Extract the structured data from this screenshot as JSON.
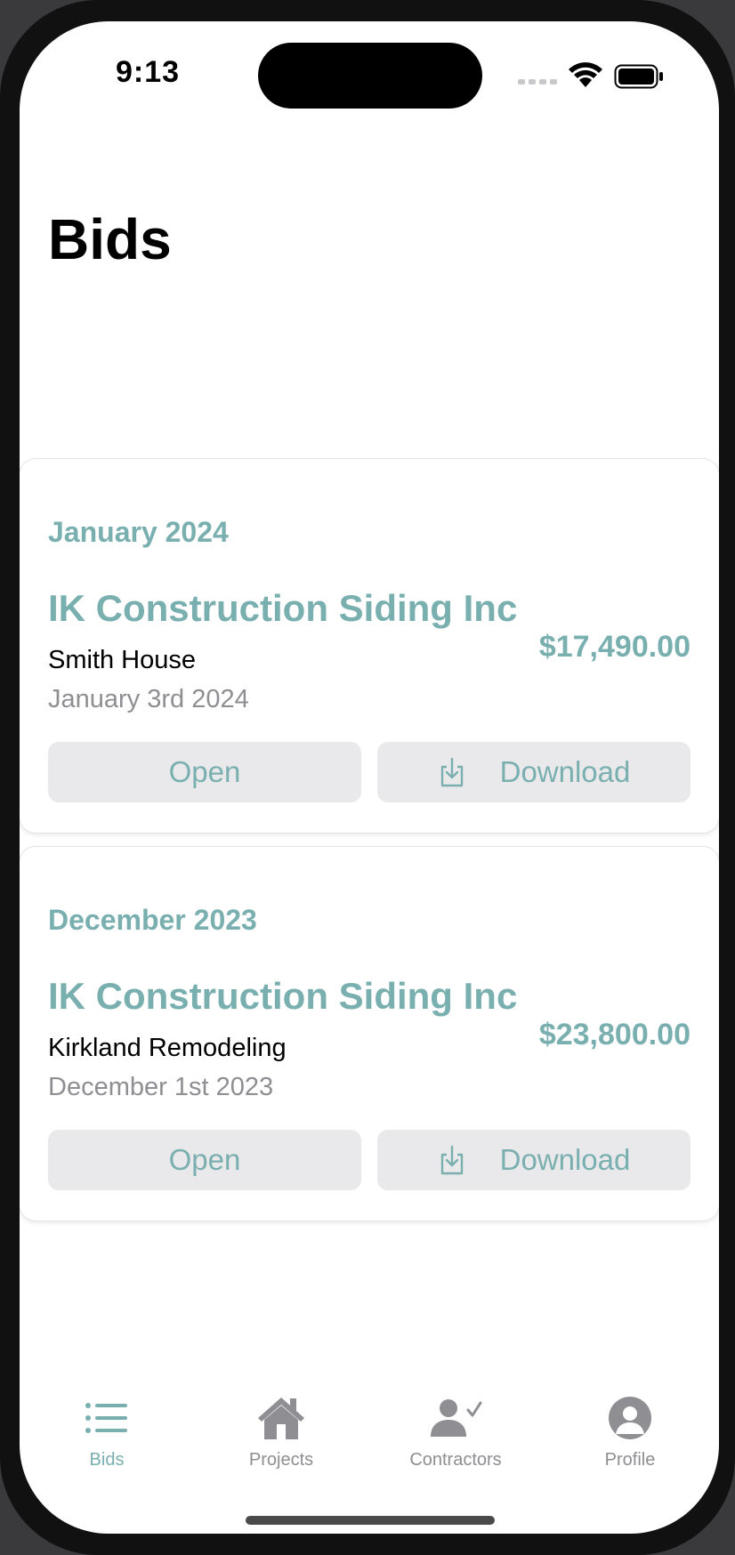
{
  "status_bar": {
    "time": "9:13"
  },
  "page": {
    "title": "Bids"
  },
  "colors": {
    "accent": "#7aafb0",
    "muted": "#8e8e93",
    "button_bg": "#e9e9eb"
  },
  "bids": [
    {
      "month": "January 2024",
      "company": "IK Construction Siding Inc",
      "project": "Smith House",
      "date": "January 3rd 2024",
      "amount": "$17,490.00",
      "open_label": "Open",
      "download_label": "Download"
    },
    {
      "month": "December 2023",
      "company": "IK Construction Siding Inc",
      "project": "Kirkland Remodeling",
      "date": "December 1st 2023",
      "amount": "$23,800.00",
      "open_label": "Open",
      "download_label": "Download"
    }
  ],
  "tab_bar": {
    "tabs": [
      {
        "label": "Bids",
        "icon": "list-icon",
        "active": true
      },
      {
        "label": "Projects",
        "icon": "house-icon",
        "active": false
      },
      {
        "label": "Contractors",
        "icon": "person-check-icon",
        "active": false
      },
      {
        "label": "Profile",
        "icon": "person-circle-icon",
        "active": false
      }
    ]
  }
}
